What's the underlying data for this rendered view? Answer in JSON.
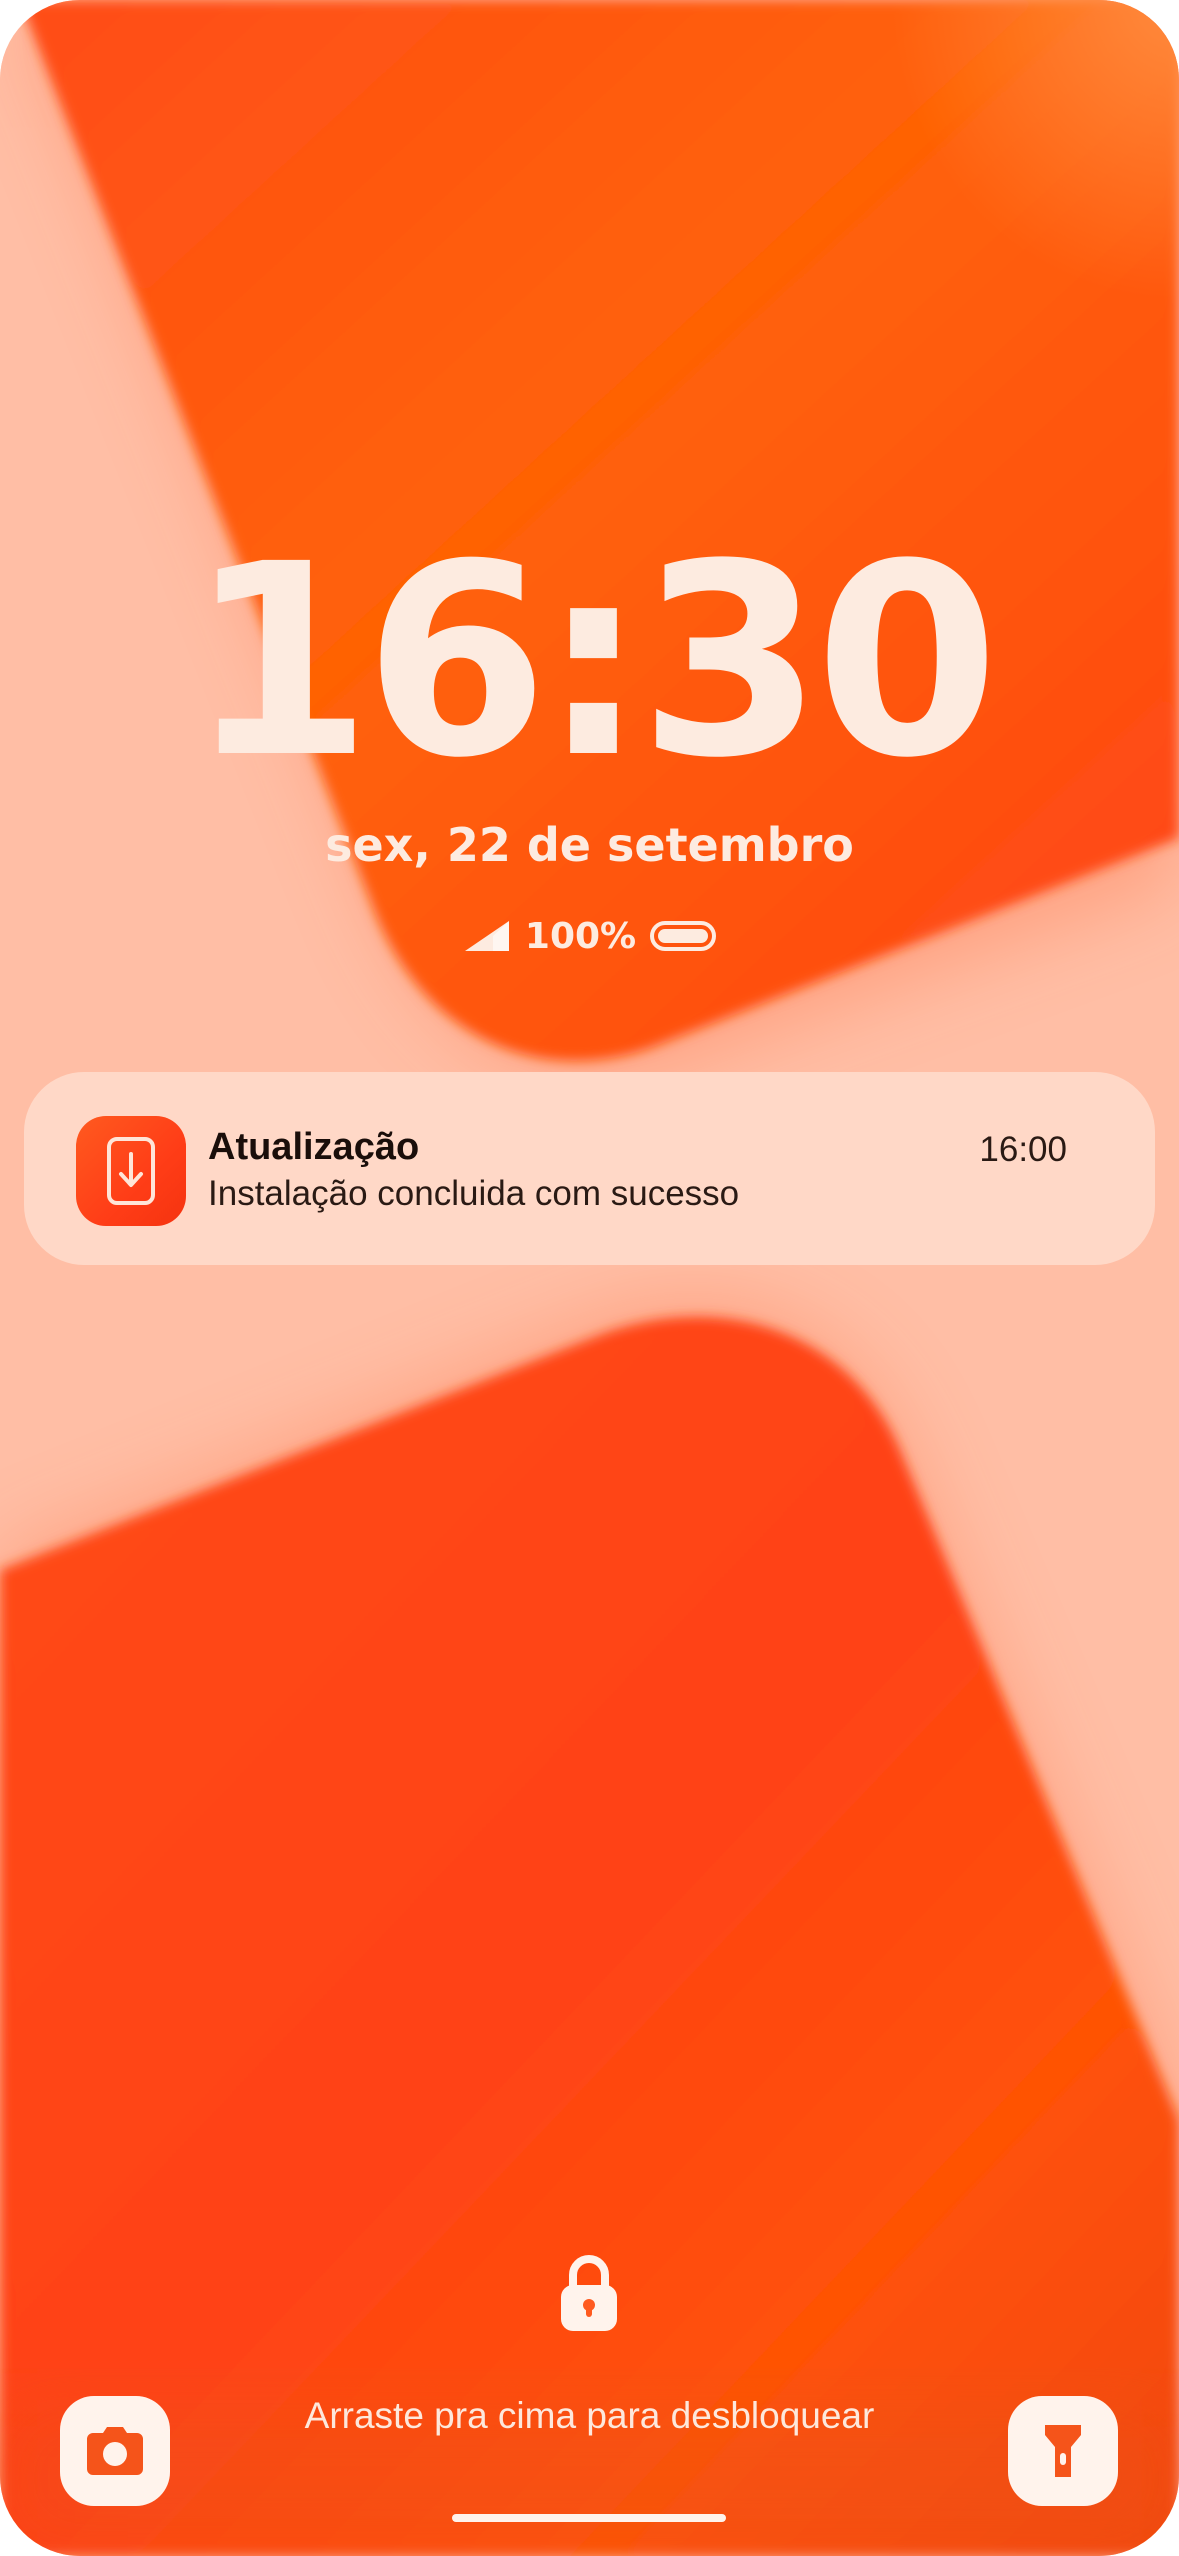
{
  "lockscreen": {
    "time": "16:30",
    "date": "sex, 22 de setembro",
    "battery_text": "100%"
  },
  "notification": {
    "app_icon": "download-icon",
    "title": "Atualização",
    "body": "Instalação concluida com sucesso",
    "time": "16:00"
  },
  "bottom": {
    "unlock_hint": "Arraste pra cima para desbloquear",
    "left_shortcut_icon": "camera-icon",
    "right_shortcut_icon": "flashlight-icon",
    "lock_icon": "lock-icon"
  },
  "colors": {
    "accent": "#ff4a1a",
    "wallpaper_light": "#ffbfa6",
    "text_light": "#fdebe0"
  }
}
